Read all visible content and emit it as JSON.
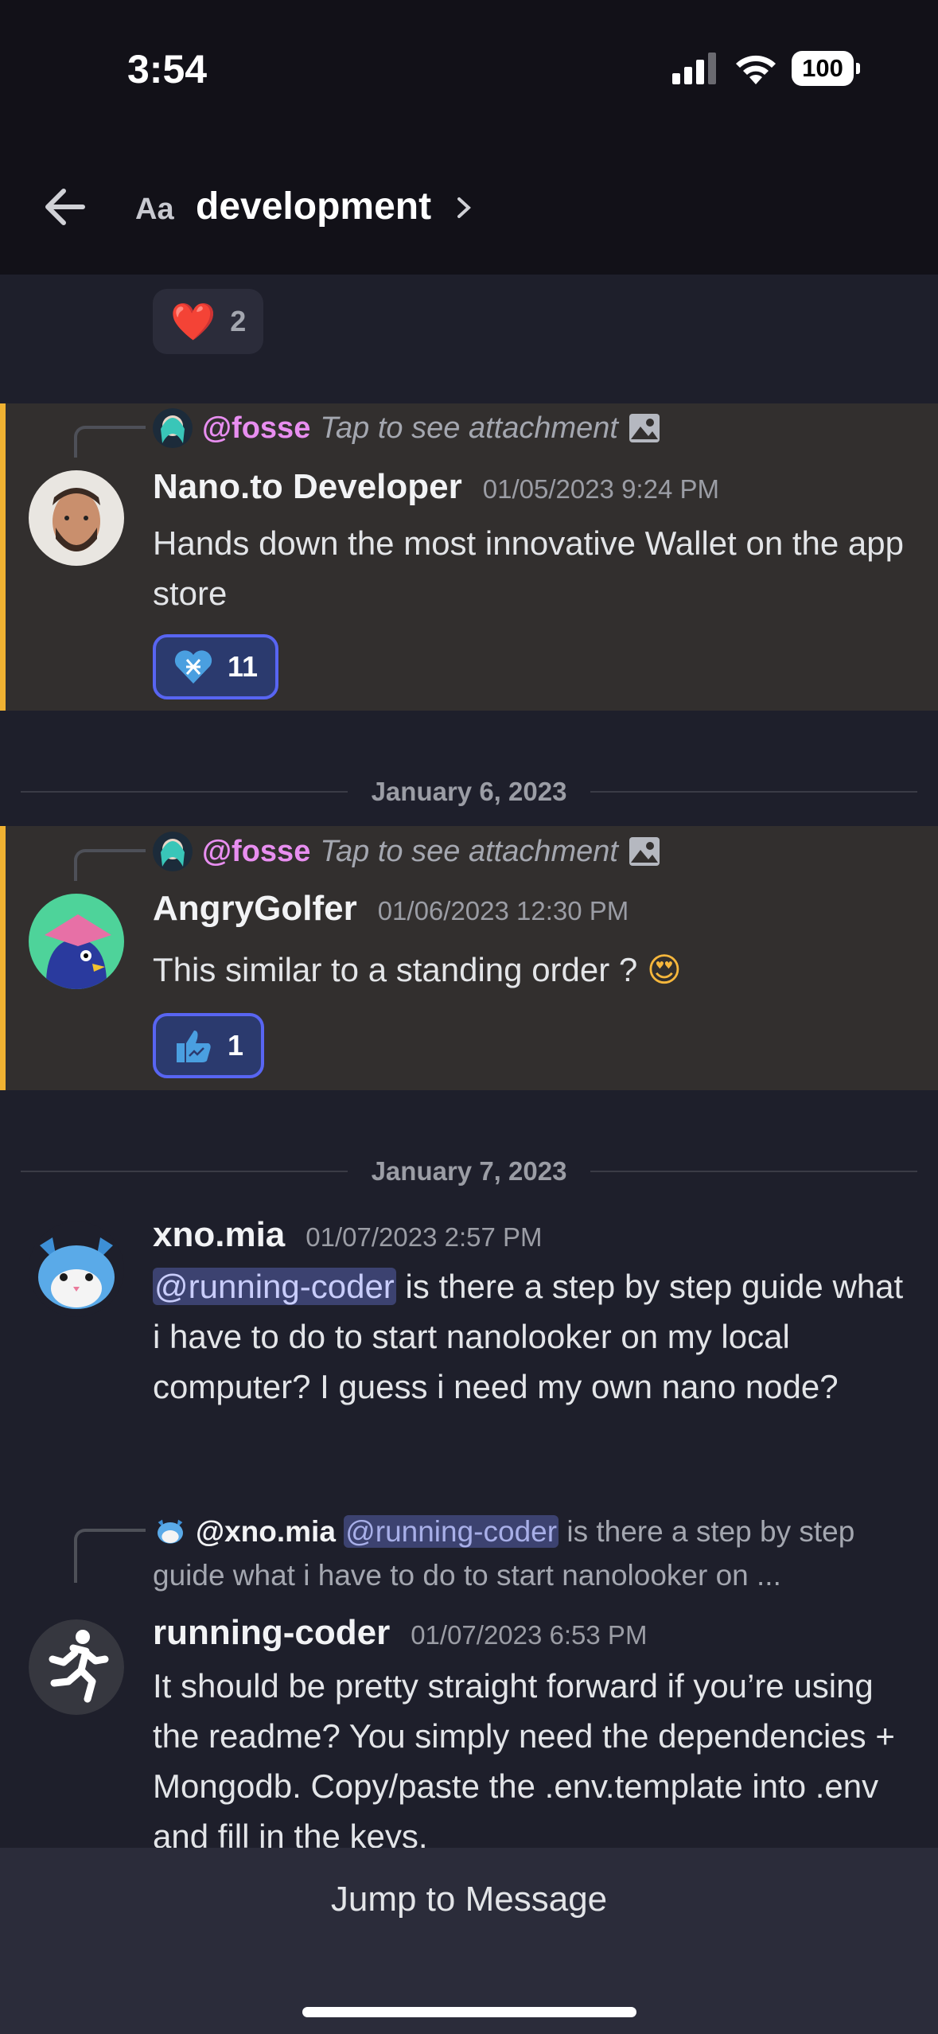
{
  "status_bar": {
    "time": "3:54",
    "battery": "100"
  },
  "header": {
    "aa_label": "Aa",
    "channel": "development"
  },
  "top_reaction": {
    "emoji": "❤️",
    "count": "2"
  },
  "messages": [
    {
      "reply": {
        "mention": "@fosse",
        "text": "Tap to see attachment"
      },
      "username": "Nano.to Developer",
      "timestamp": "01/05/2023 9:24 PM",
      "body": "Hands down the most innovative Wallet on the app store",
      "reaction": {
        "count": "11"
      }
    },
    {
      "reply": {
        "mention": "@fosse",
        "text": "Tap to see attachment"
      },
      "username": "AngryGolfer",
      "timestamp": "01/06/2023 12:30 PM",
      "body": "This similar to a standing order ?",
      "body_emoji": "😍",
      "reaction": {
        "count": "1"
      }
    },
    {
      "username": "xno.mia",
      "timestamp": "01/07/2023 2:57 PM",
      "mention": "@running-coder",
      "body": " is there a step by step guide what i have to do to start nanolooker on my local computer? I guess i need my own nano node?"
    },
    {
      "reply": {
        "name": "@xno.mia",
        "mention": "@running-coder",
        "text": " is there a step by step guide what i have to do to start nanolooker on ..."
      },
      "username": "running-coder",
      "timestamp": "01/07/2023 6:53 PM",
      "body": "It should be pretty straight forward if you’re using the readme? You simply need the dependencies + Mongodb. Copy/paste the .env.template into .env and fill in the keys."
    }
  ],
  "dividers": [
    "January 6, 2023",
    "January 7, 2023"
  ],
  "jump_label": "Jump to Message"
}
